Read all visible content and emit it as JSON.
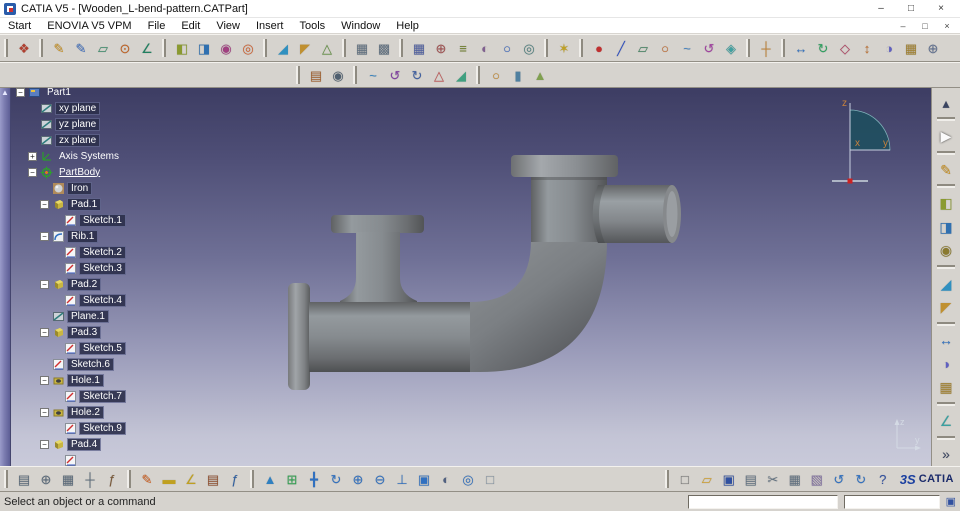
{
  "window": {
    "title": "CATIA V5 - [Wooden_L-bend-pattern.CATPart]",
    "controls": {
      "minimize": "–",
      "maximize": "□",
      "close": "×"
    }
  },
  "menu": {
    "items": [
      "Start",
      "ENOVIA V5 VPM",
      "File",
      "Edit",
      "View",
      "Insert",
      "Tools",
      "Window",
      "Help"
    ],
    "controls": {
      "minimize": "–",
      "restore": "□",
      "close": "×"
    }
  },
  "toolbars": {
    "row1_groups": [
      [
        {
          "name": "workbench-icon",
          "glyph": "❖",
          "color": "#b04030"
        }
      ],
      [
        {
          "name": "sketcher-icon",
          "glyph": "✎",
          "color": "#c89020"
        },
        {
          "name": "positioned-sketch-icon",
          "glyph": "✎",
          "color": "#4070c0"
        },
        {
          "name": "work-on-support-icon",
          "glyph": "▱",
          "color": "#3a8a6a"
        },
        {
          "name": "snap-to-point-icon",
          "glyph": "⊙",
          "color": "#c06020"
        },
        {
          "name": "constraints-icon",
          "glyph": "∠",
          "color": "#208060"
        }
      ],
      [
        {
          "name": "pad-icon",
          "glyph": "◧",
          "color": "#8a9a30"
        },
        {
          "name": "pocket-icon",
          "glyph": "◨",
          "color": "#3070b0"
        },
        {
          "name": "shaft-icon",
          "glyph": "◉",
          "color": "#a04080"
        },
        {
          "name": "groove-icon",
          "glyph": "◎",
          "color": "#d06030"
        }
      ],
      [
        {
          "name": "fillet-icon",
          "glyph": "◢",
          "color": "#3090c0"
        },
        {
          "name": "chamfer-icon",
          "glyph": "◤",
          "color": "#c09030"
        },
        {
          "name": "draft-icon",
          "glyph": "△",
          "color": "#609040"
        }
      ],
      [
        {
          "name": "split-view-icon",
          "glyph": "▦",
          "color": "#607080"
        },
        {
          "name": "tile-window-icon",
          "glyph": "▩",
          "color": "#607080"
        }
      ],
      [
        {
          "name": "grid-icon",
          "glyph": "▦",
          "color": "#5060a0"
        },
        {
          "name": "snap-grid-icon",
          "glyph": "⊕",
          "color": "#a05050"
        },
        {
          "name": "layers-icon",
          "glyph": "≡",
          "color": "#708030"
        },
        {
          "name": "visualization-icon",
          "glyph": "◐",
          "color": "#806090"
        },
        {
          "name": "magnifier-icon",
          "glyph": "○",
          "color": "#3060c0"
        },
        {
          "name": "depth-effect-icon",
          "glyph": "◎",
          "color": "#508080"
        }
      ],
      [
        {
          "name": "lighting-icon",
          "glyph": "✶",
          "color": "#c0a020"
        }
      ],
      [
        {
          "name": "point-icon",
          "glyph": "●",
          "color": "#c03030"
        },
        {
          "name": "line-icon",
          "glyph": "╱",
          "color": "#3050c0"
        },
        {
          "name": "plane-icon",
          "glyph": "▱",
          "color": "#408060"
        },
        {
          "name": "circle-icon",
          "glyph": "○",
          "color": "#c06020"
        },
        {
          "name": "spline-icon",
          "glyph": "~",
          "color": "#4080c0"
        },
        {
          "name": "helix-icon",
          "glyph": "↺",
          "color": "#a040a0"
        },
        {
          "name": "surface-icon",
          "glyph": "◈",
          "color": "#40a0a0"
        }
      ],
      [
        {
          "name": "axis-icon",
          "glyph": "┼",
          "color": "#c08030"
        }
      ],
      [
        {
          "name": "translate-icon",
          "glyph": "↔",
          "color": "#3070c0"
        },
        {
          "name": "rotate-tool-icon",
          "glyph": "↻",
          "color": "#30a060"
        },
        {
          "name": "symmetry-icon",
          "glyph": "◇",
          "color": "#b04060"
        },
        {
          "name": "scale-icon",
          "glyph": "↕",
          "color": "#c07030"
        },
        {
          "name": "mirror-icon",
          "glyph": "◑",
          "color": "#6060c0"
        },
        {
          "name": "pattern-icon",
          "glyph": "▦",
          "color": "#a08030"
        },
        {
          "name": "boolean-icon",
          "glyph": "⊕",
          "color": "#607090"
        }
      ]
    ],
    "row2_groups": [
      [
        {
          "name": "catalog-icon",
          "glyph": "▤",
          "color": "#a06030"
        },
        {
          "name": "camera-icon",
          "glyph": "◉",
          "color": "#506070"
        }
      ],
      [
        {
          "name": "spline2-icon",
          "glyph": "~",
          "color": "#3080c0"
        },
        {
          "name": "spiral-icon",
          "glyph": "↺",
          "color": "#8040a0"
        },
        {
          "name": "helix2-icon",
          "glyph": "↻",
          "color": "#4060a0"
        },
        {
          "name": "conic-icon",
          "glyph": "△",
          "color": "#c05050"
        },
        {
          "name": "corner-icon",
          "glyph": "◢",
          "color": "#40a080"
        }
      ],
      [
        {
          "name": "arc-icon",
          "glyph": "○",
          "color": "#c08020"
        },
        {
          "name": "cylinder-icon",
          "glyph": "▮",
          "color": "#5080a0"
        },
        {
          "name": "cone-icon",
          "glyph": "▲",
          "color": "#80a050"
        }
      ]
    ],
    "right_groups": [
      [
        {
          "name": "scroll-up-icon",
          "glyph": "▴",
          "color": "#3a4460"
        }
      ],
      [
        {
          "name": "select-icon",
          "glyph": "▶",
          "color": "#fafafa"
        }
      ],
      [
        {
          "name": "sketcher-side-icon",
          "glyph": "✎",
          "color": "#c89020"
        }
      ],
      [
        {
          "name": "pad-side-icon",
          "glyph": "◧",
          "color": "#8a9a30"
        },
        {
          "name": "pocket-side-icon",
          "glyph": "◨",
          "color": "#3070b0"
        },
        {
          "name": "hole-side-icon",
          "glyph": "◉",
          "color": "#8a7a30"
        }
      ],
      [
        {
          "name": "fillet-side-icon",
          "glyph": "◢",
          "color": "#3090c0"
        },
        {
          "name": "chamfer-side-icon",
          "glyph": "◤",
          "color": "#c09030"
        }
      ],
      [
        {
          "name": "transformation-icon",
          "glyph": "↔",
          "color": "#3070c0"
        },
        {
          "name": "mirror-side-icon",
          "glyph": "◑",
          "color": "#6060c0"
        },
        {
          "name": "pattern-side-icon",
          "glyph": "▦",
          "color": "#a08030"
        }
      ],
      [
        {
          "name": "measure-icon",
          "glyph": "∠",
          "color": "#3aa0a0"
        }
      ],
      [
        {
          "name": "more-tools-icon",
          "glyph": "»",
          "color": "#3a4460"
        }
      ]
    ],
    "bottom_left_groups": [
      [
        {
          "name": "graph-tree-icon",
          "glyph": "▤",
          "color": "#5a6a7a"
        },
        {
          "name": "center-graph-icon",
          "glyph": "⊕",
          "color": "#5a6a7a"
        },
        {
          "name": "reframe-icon",
          "glyph": "▦",
          "color": "#5a6a7a"
        },
        {
          "name": "compass-tool-icon",
          "glyph": "┼",
          "color": "#5a6a7a"
        },
        {
          "name": "parameters-icon",
          "glyph": "ƒ",
          "color": "#7a5a3a"
        }
      ],
      [
        {
          "name": "pen-icon",
          "glyph": "✎",
          "color": "#d06020"
        },
        {
          "name": "ruler-icon",
          "glyph": "▬",
          "color": "#c0a020"
        },
        {
          "name": "protractor-icon",
          "glyph": "∠",
          "color": "#c0a020"
        },
        {
          "name": "catalog-browser-icon",
          "glyph": "▤",
          "color": "#905030"
        },
        {
          "name": "knowledge-icon",
          "glyph": "ƒ",
          "color": "#3060a0"
        }
      ]
    ],
    "bottom_view_group": [
      {
        "name": "fly-mode-icon",
        "glyph": "▲",
        "color": "#3080c0"
      },
      {
        "name": "fit-all-icon",
        "glyph": "⊞",
        "color": "#30a050"
      },
      {
        "name": "pan-icon",
        "glyph": "╋",
        "color": "#3070c0"
      },
      {
        "name": "rotate-view-icon",
        "glyph": "↻",
        "color": "#3070c0"
      },
      {
        "name": "zoom-in-icon",
        "glyph": "⊕",
        "color": "#3070c0"
      },
      {
        "name": "zoom-out-icon",
        "glyph": "⊖",
        "color": "#3070c0"
      },
      {
        "name": "normal-view-icon",
        "glyph": "⊥",
        "color": "#3070c0"
      },
      {
        "name": "iso-view-icon",
        "glyph": "▣",
        "color": "#3070c0"
      },
      {
        "name": "render-style-icon",
        "glyph": "◐",
        "color": "#506080"
      },
      {
        "name": "hide-show-icon",
        "glyph": "◎",
        "color": "#3070c0"
      },
      {
        "name": "full-screen-icon",
        "glyph": "□",
        "color": "#8090a0"
      }
    ],
    "bottom_standard_group": [
      {
        "name": "new-icon",
        "glyph": "□",
        "color": "#707070"
      },
      {
        "name": "open-icon",
        "glyph": "▱",
        "color": "#d0a030"
      },
      {
        "name": "save-icon",
        "glyph": "▣",
        "color": "#3050a0"
      },
      {
        "name": "print-icon",
        "glyph": "▤",
        "color": "#607080"
      },
      {
        "name": "cut-icon",
        "glyph": "✂",
        "color": "#607080"
      },
      {
        "name": "copy-icon",
        "glyph": "▦",
        "color": "#607080"
      },
      {
        "name": "paste-icon",
        "glyph": "▧",
        "color": "#8070a0"
      },
      {
        "name": "undo-icon",
        "glyph": "↺",
        "color": "#3070c0"
      },
      {
        "name": "redo-icon",
        "glyph": "↻",
        "color": "#3070c0"
      },
      {
        "name": "help-icon",
        "glyph": "?",
        "color": "#3050a0"
      }
    ]
  },
  "tree": {
    "items": [
      {
        "label": "Part1",
        "icon": "part",
        "level": 0,
        "box": false,
        "expander": "minus"
      },
      {
        "label": "xy plane",
        "icon": "plane",
        "level": 1,
        "box": true,
        "expander": null
      },
      {
        "label": "yz plane",
        "icon": "plane",
        "level": 1,
        "box": true,
        "expander": null
      },
      {
        "label": "zx plane",
        "icon": "plane",
        "level": 1,
        "box": true,
        "expander": null
      },
      {
        "label": "Axis Systems",
        "icon": "axes",
        "level": 1,
        "box": false,
        "expander": "plus"
      },
      {
        "label": "PartBody",
        "icon": "partbody",
        "level": 1,
        "box": false,
        "underline": true,
        "expander": "minus"
      },
      {
        "label": "Iron",
        "icon": "material",
        "level": 2,
        "box": true,
        "expander": null
      },
      {
        "label": "Pad.1",
        "icon": "pad",
        "level": 2,
        "box": true,
        "expander": "minus"
      },
      {
        "label": "Sketch.1",
        "icon": "sketch",
        "level": 3,
        "box": true,
        "expander": null
      },
      {
        "label": "Rib.1",
        "icon": "rib",
        "level": 2,
        "box": true,
        "expander": "minus"
      },
      {
        "label": "Sketch.2",
        "icon": "sketch",
        "level": 3,
        "box": true,
        "expander": null
      },
      {
        "label": "Sketch.3",
        "icon": "sketch",
        "level": 3,
        "box": true,
        "expander": null
      },
      {
        "label": "Pad.2",
        "icon": "pad",
        "level": 2,
        "box": true,
        "expander": "minus"
      },
      {
        "label": "Sketch.4",
        "icon": "sketch",
        "level": 3,
        "box": true,
        "expander": null
      },
      {
        "label": "Plane.1",
        "icon": "plane",
        "level": 2,
        "box": true,
        "expander": null
      },
      {
        "label": "Pad.3",
        "icon": "pad",
        "level": 2,
        "box": true,
        "expander": "minus"
      },
      {
        "label": "Sketch.5",
        "icon": "sketch",
        "level": 3,
        "box": true,
        "expander": null
      },
      {
        "label": "Sketch.6",
        "icon": "sketch",
        "level": 2,
        "box": true,
        "expander": null
      },
      {
        "label": "Hole.1",
        "icon": "hole",
        "level": 2,
        "box": true,
        "expander": "minus"
      },
      {
        "label": "Sketch.7",
        "icon": "sketch",
        "level": 3,
        "box": true,
        "expander": null
      },
      {
        "label": "Hole.2",
        "icon": "hole",
        "level": 2,
        "box": true,
        "expander": "minus"
      },
      {
        "label": "Sketch.9",
        "icon": "sketch",
        "level": 3,
        "box": true,
        "expander": null
      },
      {
        "label": "Pad.4",
        "icon": "pad",
        "level": 2,
        "box": true,
        "expander": "minus"
      },
      {
        "label": "",
        "icon": "sketch",
        "level": 3,
        "box": true,
        "expander": null
      }
    ]
  },
  "compass": {
    "z_label": "z",
    "y_label": "y",
    "x_label": "x"
  },
  "axis_indicator": {
    "z_label": "z",
    "y_label": "y"
  },
  "status": {
    "message": "Select an object or a command",
    "field1": "",
    "field2": ""
  },
  "logo": {
    "mark": "3S",
    "brand": "CATIA"
  },
  "colors": {
    "accent": "#2a5caa",
    "toolbar_bg": "#d6d3ce",
    "viewport_top": "#3d3d63",
    "viewport_bottom": "#c9cada",
    "model_gray": "#85878a",
    "tree_highlight": "#2c304c",
    "compass_fill": "#1e4f5e",
    "compass_label": "#c8823c",
    "origin_dot": "#cc2222"
  }
}
